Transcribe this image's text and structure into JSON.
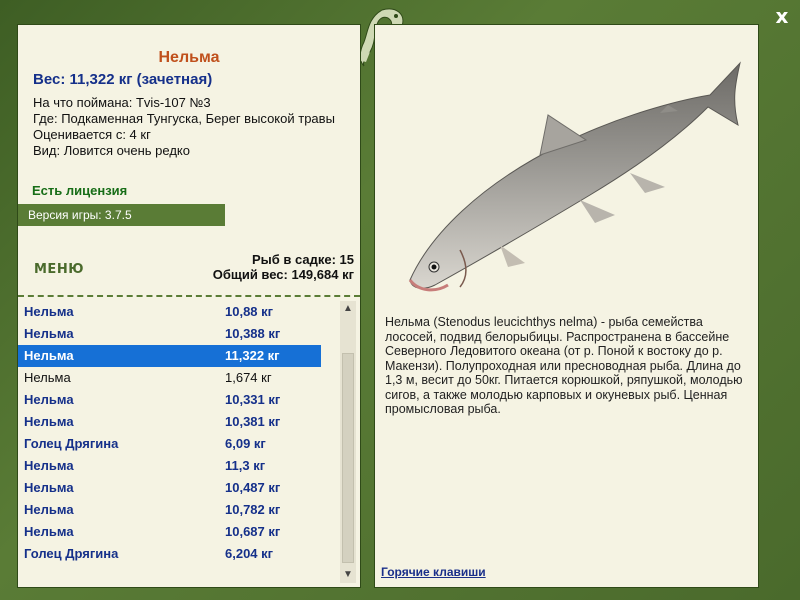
{
  "header": {
    "close_label": "x"
  },
  "fish": {
    "name": "Нельма",
    "weight": "Вес: 11,322 кг (зачетная)",
    "caught_on": "На что поймана: Tvis-107 №3",
    "location": "Где: Подкаменная Тунгуска, Берег высокой травы",
    "valued": "Оценивается с: 4 кг",
    "rarity": "Вид: Ловится очень редко"
  },
  "license": "Есть лицензия",
  "version": "Версия игры: 3.7.5",
  "menu_label": "МЕНЮ",
  "stats": {
    "fish_in_keepnet": "Рыб в садке: 15",
    "total_weight": "Общий вес: 149,684 кг"
  },
  "catch_list": [
    {
      "name": "Нельма",
      "weight": "10,88 кг",
      "style": "bold"
    },
    {
      "name": "Нельма",
      "weight": "10,388 кг",
      "style": "bold"
    },
    {
      "name": "Нельма",
      "weight": "11,322 кг",
      "style": "sel"
    },
    {
      "name": "Нельма",
      "weight": "1,674 кг",
      "style": "plain"
    },
    {
      "name": "Нельма",
      "weight": "10,331 кг",
      "style": "bold"
    },
    {
      "name": "Нельма",
      "weight": "10,381 кг",
      "style": "bold"
    },
    {
      "name": "Голец Дрягина",
      "weight": "6,09 кг",
      "style": "bold"
    },
    {
      "name": "Нельма",
      "weight": "11,3 кг",
      "style": "bold"
    },
    {
      "name": "Нельма",
      "weight": "10,487 кг",
      "style": "bold"
    },
    {
      "name": "Нельма",
      "weight": "10,782 кг",
      "style": "bold"
    },
    {
      "name": "Нельма",
      "weight": "10,687 кг",
      "style": "bold"
    },
    {
      "name": "Голец Дрягина",
      "weight": "6,204 кг",
      "style": "bold"
    }
  ],
  "description": "Нельма (Stenodus leucichthys nelma) - рыба семейства лососей, подвид белорыбицы. Распространена в бассейне Северного Ледовитого океана (от р. Поной к востоку до р. Макензи). Полупроходная или пресноводная рыба. Длина до 1,3 м, весит до 50кг. Питается корюшкой, ряпушкой, молодью сигов, а также молодью карповых и окуневых рыб. Ценная промысловая рыба.",
  "hotkeys_label": "Горячие клавиши",
  "colors": {
    "frame": "#4a6a2c",
    "panel": "#f5f3e3",
    "selection": "#1670d6",
    "title": "#c0501c",
    "accent_text": "#15308a"
  }
}
